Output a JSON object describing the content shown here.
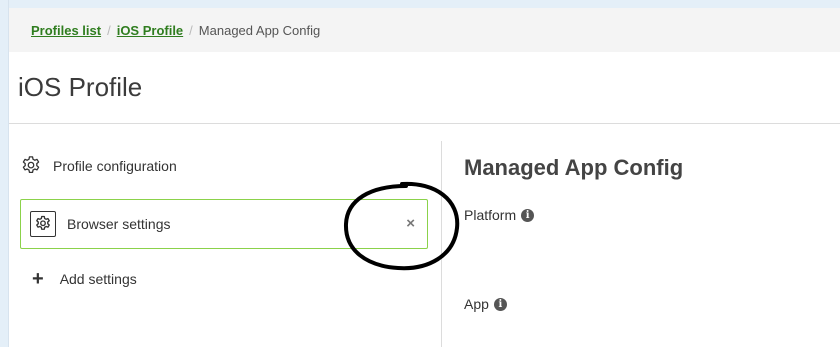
{
  "breadcrumb": {
    "items": [
      {
        "label": "Profiles list"
      },
      {
        "label": "iOS Profile"
      },
      {
        "label": "Managed App Config"
      }
    ],
    "separator": "/"
  },
  "page_title": "iOS Profile",
  "sidebar": {
    "items": [
      {
        "label": "Profile configuration",
        "icon": "gear-icon"
      },
      {
        "label": "Browser settings",
        "icon": "gear-box-icon",
        "active": true,
        "remove_glyph": "×"
      },
      {
        "label": "Add settings",
        "icon": "plus-icon",
        "glyph": "+"
      }
    ]
  },
  "main": {
    "title": "Managed App Config",
    "fields": [
      {
        "label": "Platform",
        "info_glyph": "i"
      },
      {
        "label": "App",
        "info_glyph": "i"
      }
    ]
  },
  "colors": {
    "breadcrumb_link": "#2f7d1f",
    "active_border": "#8bd24a",
    "frame": "#e4eff8"
  }
}
